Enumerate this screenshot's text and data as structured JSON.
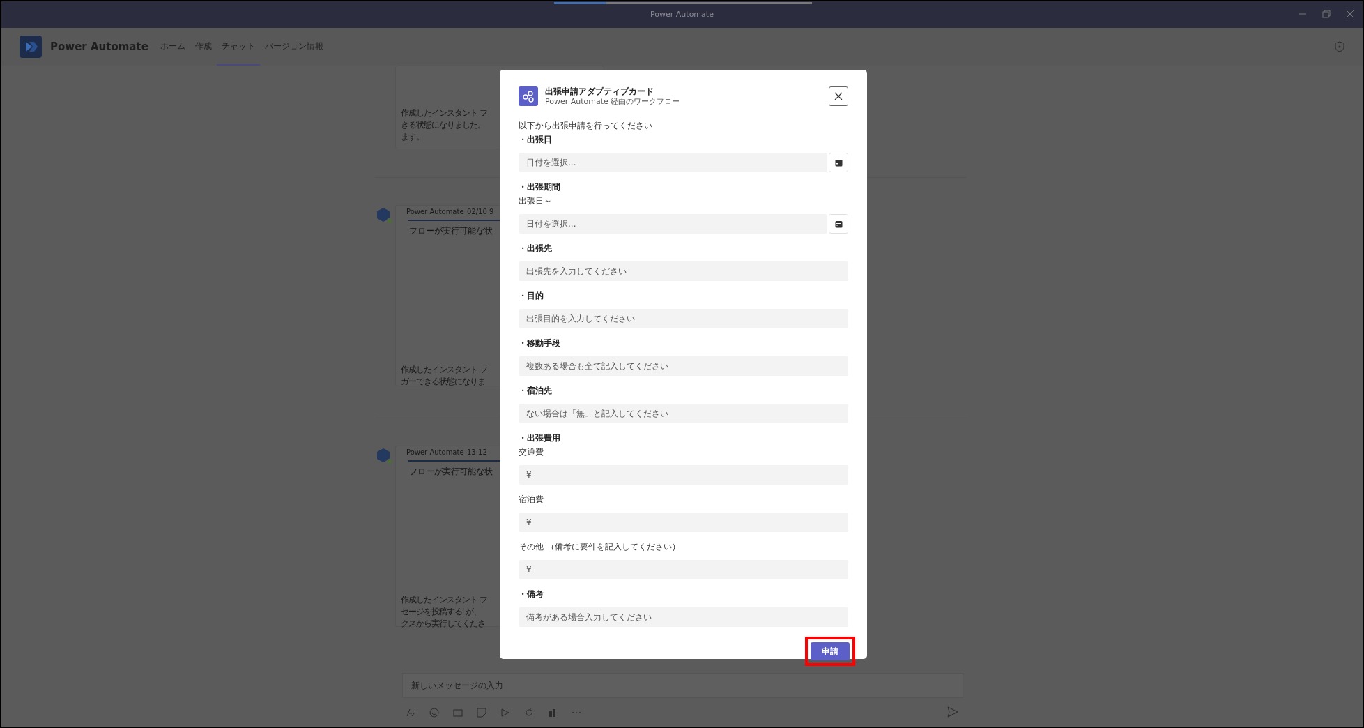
{
  "window": {
    "title": "Power Automate"
  },
  "app_header": {
    "app_name": "Power Automate",
    "tabs": [
      {
        "label": "ホーム",
        "selected": false
      },
      {
        "label": "作成",
        "selected": false
      },
      {
        "label": "チャット",
        "selected": true
      },
      {
        "label": "バージョン情報",
        "selected": false
      }
    ]
  },
  "chat": {
    "messages": [
      {
        "lines": [
          "作成したインスタント フ",
          "きる状態になりました。",
          "ます。"
        ]
      },
      {
        "sender": "Power Automate",
        "time": "02/10 9",
        "headline": "フローが実行可能な状",
        "lines": [
          "作成したインスタント フ",
          "ガーできる状態になりま"
        ]
      },
      {
        "sender": "Power Automate",
        "time": "13:12",
        "headline": "フローが実行可能な状",
        "lines": [
          "作成したインスタント フ",
          "セージを投稿する' が、",
          "クスから実行してくださ"
        ]
      }
    ]
  },
  "compose": {
    "placeholder": "新しいメッセージの入力"
  },
  "dialog": {
    "title": "出張申請アダプティブカード",
    "subtitle": "Power Automate 経由のワークフロー",
    "intro": "以下から出張申請を行ってください",
    "items": [
      {
        "kind": "heading",
        "text": "・出張日"
      },
      {
        "kind": "date",
        "placeholder": "日付を選択..."
      },
      {
        "kind": "heading",
        "text": "・出張期間"
      },
      {
        "kind": "label",
        "text": "出張日～"
      },
      {
        "kind": "date",
        "placeholder": "日付を選択..."
      },
      {
        "kind": "heading",
        "text": "・出張先"
      },
      {
        "kind": "input",
        "placeholder": "出張先を入力してください"
      },
      {
        "kind": "heading",
        "text": "・目的"
      },
      {
        "kind": "input",
        "placeholder": "出張目的を入力してください"
      },
      {
        "kind": "heading",
        "text": "・移動手段"
      },
      {
        "kind": "input",
        "placeholder": "複数ある場合も全て記入してください"
      },
      {
        "kind": "heading",
        "text": "・宿泊先"
      },
      {
        "kind": "input",
        "placeholder": "ない場合は「無」と記入してください"
      },
      {
        "kind": "heading",
        "text": "・出張費用"
      },
      {
        "kind": "label",
        "text": "交通費"
      },
      {
        "kind": "input",
        "placeholder": "¥"
      },
      {
        "kind": "label",
        "text": "宿泊費"
      },
      {
        "kind": "input",
        "placeholder": "¥"
      },
      {
        "kind": "label",
        "text": "その他 （備考に要件を記入してください）"
      },
      {
        "kind": "input",
        "placeholder": "¥"
      },
      {
        "kind": "heading",
        "text": "・備考"
      },
      {
        "kind": "input",
        "placeholder": "備考がある場合入力してください"
      }
    ],
    "submit": {
      "label": "申請",
      "highlighted": true
    }
  }
}
